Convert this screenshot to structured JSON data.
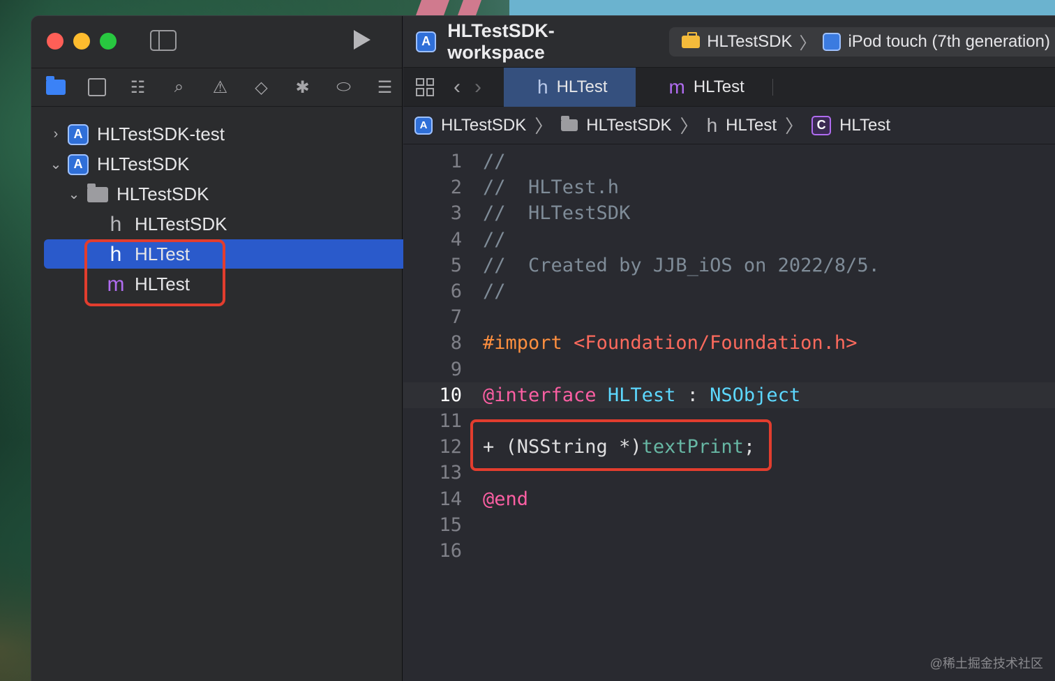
{
  "window": {
    "run_label": "Run"
  },
  "sidebar": {
    "tree": [
      {
        "label": "HLTestSDK-test",
        "expanded": false,
        "kind": "project"
      },
      {
        "label": "HLTestSDK",
        "expanded": true,
        "kind": "project"
      },
      {
        "label": "HLTestSDK",
        "expanded": true,
        "kind": "folder"
      },
      {
        "label": "HLTestSDK",
        "kind": "header-file",
        "glyph": "h"
      },
      {
        "label": "HLTest",
        "kind": "header-file",
        "glyph": "h",
        "selected": true
      },
      {
        "label": "HLTest",
        "kind": "impl-file",
        "glyph": "m"
      }
    ]
  },
  "editor": {
    "workspace_title": "HLTestSDK-workspace",
    "scheme": {
      "target": "HLTestSDK",
      "device": "iPod touch (7th generation)"
    },
    "tabs": [
      {
        "label": "HLTest",
        "glyph": "h",
        "active": true
      },
      {
        "label": "HLTest",
        "glyph": "m",
        "active": false
      }
    ],
    "jumpbar": [
      {
        "label": "HLTestSDK"
      },
      {
        "label": "HLTestSDK"
      },
      {
        "label": "HLTest",
        "glyph": "h"
      },
      {
        "label": "HLTest",
        "glyph": "C"
      }
    ],
    "current_line": 10,
    "lines": [
      "//",
      "//  HLTest.h",
      "//  HLTestSDK",
      "//",
      "//  Created by JJB_iOS on 2022/8/5.",
      "//",
      "",
      "#import <Foundation/Foundation.h>",
      "",
      "@interface HLTest : NSObject",
      "",
      "+ (NSString *)textPrint;",
      "",
      "@end",
      "",
      ""
    ],
    "line_numbers": [
      "1",
      "2",
      "3",
      "4",
      "5",
      "6",
      "7",
      "8",
      "9",
      "10",
      "11",
      "12",
      "13",
      "14",
      "15",
      "16"
    ]
  },
  "watermark": "@稀土掘金技术社区",
  "colors": {
    "accent": "#2a5acb",
    "highlight_box": "#e23d2e"
  },
  "icons": {
    "nav": [
      "folder-icon",
      "source-control-icon",
      "hierarchy-icon",
      "search-icon",
      "warning-icon",
      "test-icon",
      "debug-icon",
      "breakpoint-icon",
      "report-icon"
    ]
  }
}
